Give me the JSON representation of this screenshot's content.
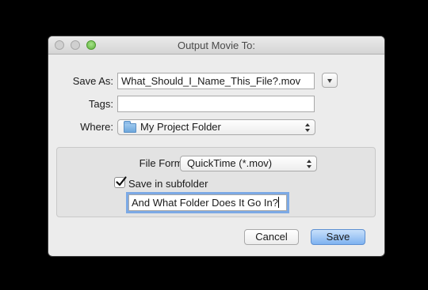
{
  "window": {
    "title": "Output Movie To:"
  },
  "form": {
    "save_as_label": "Save As:",
    "save_as_value": "What_Should_I_Name_This_File?.mov",
    "tags_label": "Tags:",
    "tags_value": "",
    "where_label": "Where:",
    "where_value": "My Project Folder"
  },
  "options": {
    "file_format_label": "File Format:",
    "file_format_value": "QuickTime (*.mov)",
    "subfolder_checkbox_label": "Save in subfolder",
    "subfolder_checked": true,
    "subfolder_value": "And What Folder Does It Go In?"
  },
  "buttons": {
    "cancel_label": "Cancel",
    "save_label": "Save"
  },
  "colors": {
    "default_button": "#7fb2f0",
    "zoom_button": "#5fb23d",
    "focus_ring": "#5a96e6"
  }
}
